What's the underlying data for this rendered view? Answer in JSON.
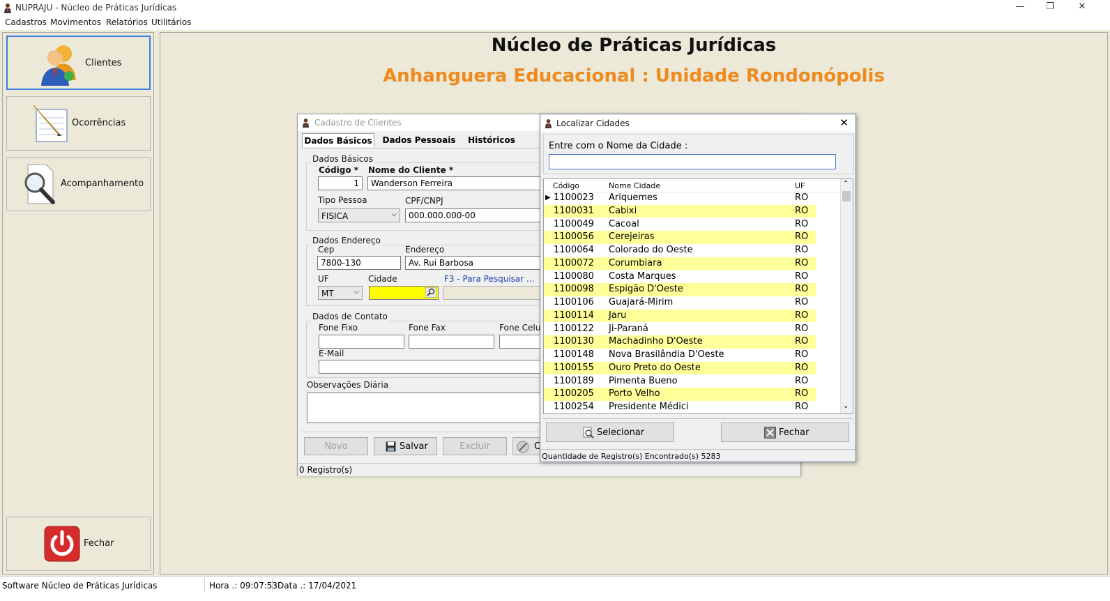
{
  "window": {
    "title": "NUPRAJU - Núcleo de Práticas Jurídicas",
    "minimize": "—",
    "restore": "❐",
    "close": "✕"
  },
  "menu": [
    "Cadastros",
    "Movimentos",
    "Relatórios",
    "Utilitários"
  ],
  "sidebar": {
    "clientes": "Clientes",
    "ocorrencias": "Ocorrências",
    "acompanhamento": "Acompanhamento",
    "fechar": "Fechar"
  },
  "header": {
    "title": "Núcleo de Práticas Jurídicas",
    "subtitle": "Anhanguera Educacional : Unidade Rondonópolis"
  },
  "cadastro": {
    "title": "Cadastro de Clientes",
    "tabs": [
      "Dados Básicos",
      "Dados Pessoais",
      "Históricos"
    ],
    "dados_basicos_group": "Dados Básicos",
    "codigo_label": "Código *",
    "codigo_value": "1",
    "nome_label": "Nome do Cliente *",
    "nome_value": "Wanderson Ferreira",
    "tipo_label": "Tipo Pessoa",
    "tipo_value": "FISICA",
    "cpf_label": "CPF/CNPJ",
    "cpf_value": "000.000.000-00",
    "endereco_group": "Dados Endereço",
    "cep_label": "Cep",
    "cep_value": "7800-130",
    "endereco_label": "Endereço",
    "endereco_value": "Av. Rui Barbosa",
    "uf_label": "UF",
    "uf_value": "MT",
    "cidade_label": "Cidade",
    "f3_hint": "F3 - Para Pesquisar ...",
    "contato_group": "Dados de Contato",
    "fone_fixo_label": "Fone Fixo",
    "fone_fax_label": "Fone Fax",
    "fone_cel_label": "Fone Celul",
    "email_label": "E-Mail",
    "obs_label": "Observações Diária",
    "btn_novo": "Novo",
    "btn_salvar": "Salvar",
    "btn_excluir": "Excluir",
    "btn_cancel_partial": "C",
    "status": "0 Registro(s)"
  },
  "localizar": {
    "title": "Localizar Cidades",
    "prompt": "Entre com o Nome da Cidade :",
    "search_value": "",
    "columns": [
      "Código",
      "Nome Cidade",
      "UF"
    ],
    "rows": [
      [
        "1100023",
        "Ariquemes",
        "RO"
      ],
      [
        "1100031",
        "Cabixi",
        "RO"
      ],
      [
        "1100049",
        "Cacoal",
        "RO"
      ],
      [
        "1100056",
        "Cerejeiras",
        "RO"
      ],
      [
        "1100064",
        "Colorado do Oeste",
        "RO"
      ],
      [
        "1100072",
        "Corumbiara",
        "RO"
      ],
      [
        "1100080",
        "Costa Marques",
        "RO"
      ],
      [
        "1100098",
        "Espigão D'Oeste",
        "RO"
      ],
      [
        "1100106",
        "Guajará-Mirim",
        "RO"
      ],
      [
        "1100114",
        "Jaru",
        "RO"
      ],
      [
        "1100122",
        "Ji-Paraná",
        "RO"
      ],
      [
        "1100130",
        "Machadinho D'Oeste",
        "RO"
      ],
      [
        "1100148",
        "Nova Brasilândia D'Oeste",
        "RO"
      ],
      [
        "1100155",
        "Ouro Preto do Oeste",
        "RO"
      ],
      [
        "1100189",
        "Pimenta Bueno",
        "RO"
      ],
      [
        "1100205",
        "Porto Velho",
        "RO"
      ],
      [
        "1100254",
        "Presidente Médici",
        "RO"
      ]
    ],
    "btn_selecionar": "Selecionar",
    "btn_fechar": "Fechar",
    "status": "Quantidade de Registro(s) Encontrado(s) 5283"
  },
  "statusbar": {
    "software": "Software Núcleo de Práticas Jurídicas",
    "hora": "Hora .: 09:07:53",
    "data": "Data .: 17/04/2021"
  },
  "colors": {
    "accent_orange": "#ef8a1e",
    "highlight_yellow": "#ffff99",
    "field_yellow": "#ffff00",
    "background": "#ece9d8"
  }
}
